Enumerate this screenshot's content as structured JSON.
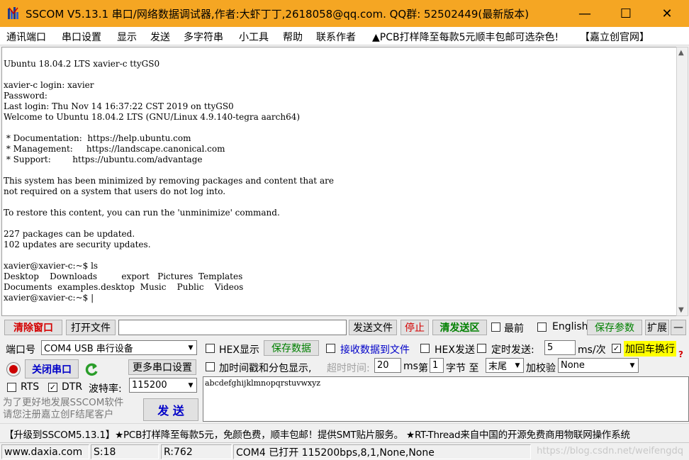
{
  "window": {
    "title": "SSCOM V5.13.1 串口/网络数据调试器,作者:大虾丁丁,2618058@qq.com. QQ群:  52502449(最新版本)",
    "minimize": "—",
    "maximize": "☐",
    "close": "✕"
  },
  "menu": {
    "items": [
      "通讯端口",
      "串口设置",
      "显示",
      "发送",
      "多字符串",
      "小工具",
      "帮助",
      "联系作者",
      "▲PCB打样降至每款5元顺丰包邮可选杂色!",
      "【嘉立创官网】"
    ]
  },
  "terminal": {
    "output": "Ubuntu 18.04.2 LTS xavier-c ttyGS0\n\nxavier-c login: xavier\nPassword:\nLast login: Thu Nov 14 16:37:22 CST 2019 on ttyGS0\nWelcome to Ubuntu 18.04.2 LTS (GNU/Linux 4.9.140-tegra aarch64)\n\n * Documentation:  https://help.ubuntu.com\n * Management:     https://landscape.canonical.com\n * Support:        https://ubuntu.com/advantage\n\nThis system has been minimized by removing packages and content that are\nnot required on a system that users do not log into.\n\nTo restore this content, you can run the 'unminimize' command.\n\n227 packages can be updated.\n102 updates are security updates.\n\nxavier@xavier-c:~$ ls\nDesktop    Downloads         export   Pictures  Templates\nDocuments  examples.desktop  Music    Public    Videos\nxavier@xavier-c:~$ |"
  },
  "toolbar1": {
    "clear_window": "清除窗口",
    "open_file": "打开文件",
    "file_path": "",
    "send_file": "发送文件",
    "stop": "停止",
    "clear_send": "清发送区",
    "latest": "最前",
    "english": "English",
    "save_params": "保存参数",
    "expand": "扩展",
    "collapse": "—"
  },
  "port": {
    "label": "端口号",
    "value": "COM4 USB 串行设备",
    "close_port": "关闭串口",
    "more_settings": "更多串口设置",
    "rts": "RTS",
    "dtr": "DTR",
    "baud_label": "波特率:",
    "baud_value": "115200"
  },
  "recv": {
    "hex_display": "HEX显示",
    "save_data": "保存数据",
    "recv_to_file": "接收数据到文件",
    "hex_send": "HEX发送",
    "timed_send": "定时发送:",
    "interval": "5",
    "interval_unit": "ms/次",
    "append_crlf": "加回车换行",
    "timestamp": "加时间戳和分包显示,",
    "timeout_label": "超时时间:",
    "timeout_value": "20",
    "timeout_unit": "ms",
    "byte_prefix": "第",
    "byte_value": "1",
    "byte_suffix": "字节 至",
    "end_value": "末尾",
    "checksum_label": "加校验",
    "checksum_value": "None",
    "help": "?"
  },
  "send": {
    "text": "abcdefghijklmnopqrstuvwxyz",
    "promo": "为了更好地发展SSCOM软件\n请您注册嘉立创F结尾客户",
    "send_button": "发 送"
  },
  "marquee": "【升级到SSCOM5.13.1】★PCB打样降至每款5元，免颜色费，顺丰包邮！提供SMT贴片服务。 ★RT-Thread来自中国的开源免费商用物联网操作系统",
  "status": {
    "site": "www.daxia.com",
    "sent": "S:18",
    "received": "R:762",
    "port_status": "COM4 已打开  115200bps,8,1,None,None",
    "watermark": "https://blog.csdn.net/weifengdq"
  },
  "colors": {
    "titlebar": "#f5a623",
    "accent_red": "#d40000",
    "accent_green": "#008000",
    "accent_blue": "#0000c8",
    "highlight_yellow": "#ffff00"
  }
}
